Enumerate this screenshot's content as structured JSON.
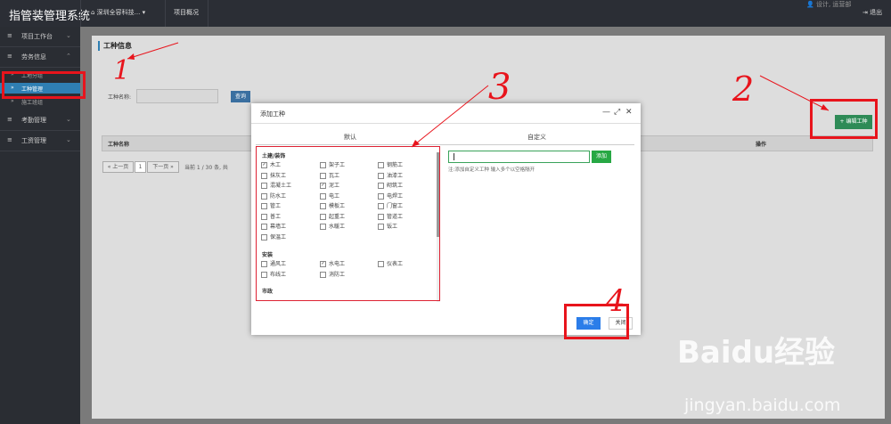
{
  "header": {
    "app_title": "指管装管理系统",
    "project_selector": "深圳全容科技...",
    "project_overview": "项目概况",
    "user": "设计, 运营部",
    "logout": "退出"
  },
  "sidebar": {
    "items": [
      {
        "label": "项目工作台"
      },
      {
        "label": "劳务信息"
      },
      {
        "label": "工地分组"
      },
      {
        "label": "工种管理"
      },
      {
        "label": "施工班组"
      },
      {
        "label": "考勤管理"
      },
      {
        "label": "工资管理"
      }
    ]
  },
  "page": {
    "title": "工种信息",
    "search_label": "工种名称:",
    "search_value": "",
    "search_button": "查询",
    "edit_button": "+ 编辑工种",
    "table_headers": {
      "name": "工种名称",
      "ops": "操作"
    },
    "pager": {
      "prev": "« 上一页",
      "page": "1",
      "next": "下一页 »",
      "info": "当前  1  /  30  条, 共"
    }
  },
  "dialog": {
    "title": "添加工种",
    "tab_default": "默认",
    "tab_custom": "自定义",
    "groups": [
      {
        "name": "土建/装饰",
        "items": [
          {
            "label": "木工",
            "checked": true
          },
          {
            "label": "架子工",
            "checked": false
          },
          {
            "label": "钢筋工",
            "checked": false
          },
          {
            "label": "抹灰工",
            "checked": false
          },
          {
            "label": "瓦工",
            "checked": false
          },
          {
            "label": "油漆工",
            "checked": false
          },
          {
            "label": "混凝土工",
            "checked": false
          },
          {
            "label": "泥工",
            "checked": true
          },
          {
            "label": "砌筑工",
            "checked": false
          },
          {
            "label": "防水工",
            "checked": false
          },
          {
            "label": "电工",
            "checked": false
          },
          {
            "label": "电焊工",
            "checked": false
          },
          {
            "label": "管工",
            "checked": false
          },
          {
            "label": "模板工",
            "checked": false
          },
          {
            "label": "门窗工",
            "checked": false
          },
          {
            "label": "普工",
            "checked": false
          },
          {
            "label": "起重工",
            "checked": false
          },
          {
            "label": "管道工",
            "checked": false
          },
          {
            "label": "幕墙工",
            "checked": false
          },
          {
            "label": "水暖工",
            "checked": false
          },
          {
            "label": "钣工",
            "checked": false
          },
          {
            "label": "保温工",
            "checked": false
          }
        ]
      },
      {
        "name": "安装",
        "items": [
          {
            "label": "通风工",
            "checked": false
          },
          {
            "label": "水电工",
            "checked": true
          },
          {
            "label": "仪表工",
            "checked": false
          },
          {
            "label": "布线工",
            "checked": false
          },
          {
            "label": "消防工",
            "checked": false
          }
        ]
      },
      {
        "name": "市政",
        "items": []
      }
    ],
    "custom_input_value": "",
    "add_button": "添加",
    "hint": "注:添加自定义工种 输入多个以空格隔开",
    "ok_button": "确定",
    "close_button": "关闭",
    "ctrl_min": "—",
    "ctrl_max": "⤢",
    "ctrl_close": "✕"
  },
  "annotations": {
    "n1": "1",
    "n2": "2",
    "n3": "3",
    "n4": "4"
  },
  "watermark": {
    "brand": "Baidu经验",
    "url": "jingyan.baidu.com"
  },
  "colors": {
    "topbar": "#2b2e35",
    "sidebar": "#2a2d33",
    "active": "#2f7fb3",
    "green": "#2e8b57",
    "primary": "#2b7de9",
    "annotation": "#e8141c"
  }
}
